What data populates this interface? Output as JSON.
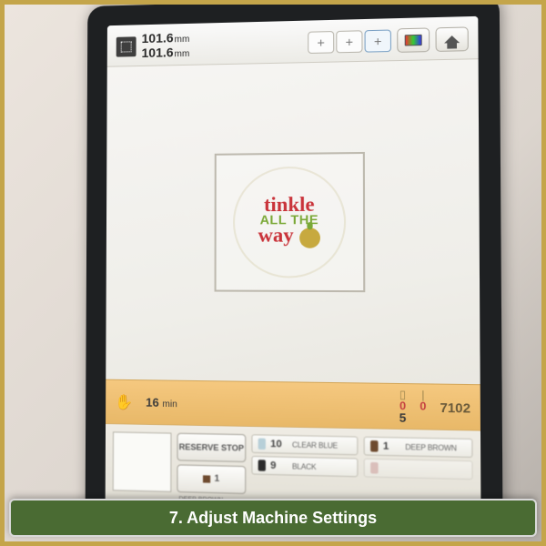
{
  "dimensions": {
    "width": "101.6",
    "height": "101.6",
    "unit": "mm"
  },
  "hoop_buttons": [
    "+",
    "+",
    "+"
  ],
  "design": {
    "line1": "tinkle",
    "line2": "ALL THE",
    "line3": "way"
  },
  "status": {
    "time_value": "16",
    "time_unit": "min",
    "spool_top": "0",
    "spool_bottom": "5",
    "needle_top": "0",
    "stitch_count": "7102"
  },
  "reserve_label": "RESERVE STOP",
  "color_indicator": {
    "num": "1",
    "name": "DEEP BROWN"
  },
  "threads": [
    {
      "num": "10",
      "name": "CLEAR BLUE",
      "color": "#b7cfd8"
    },
    {
      "num": "9",
      "name": "BLACK",
      "color": "#2b2b2b"
    },
    {
      "num": "1",
      "name": "DEEP BROWN",
      "color": "#6e4a2e"
    }
  ],
  "caption": "7. Adjust Machine Settings"
}
